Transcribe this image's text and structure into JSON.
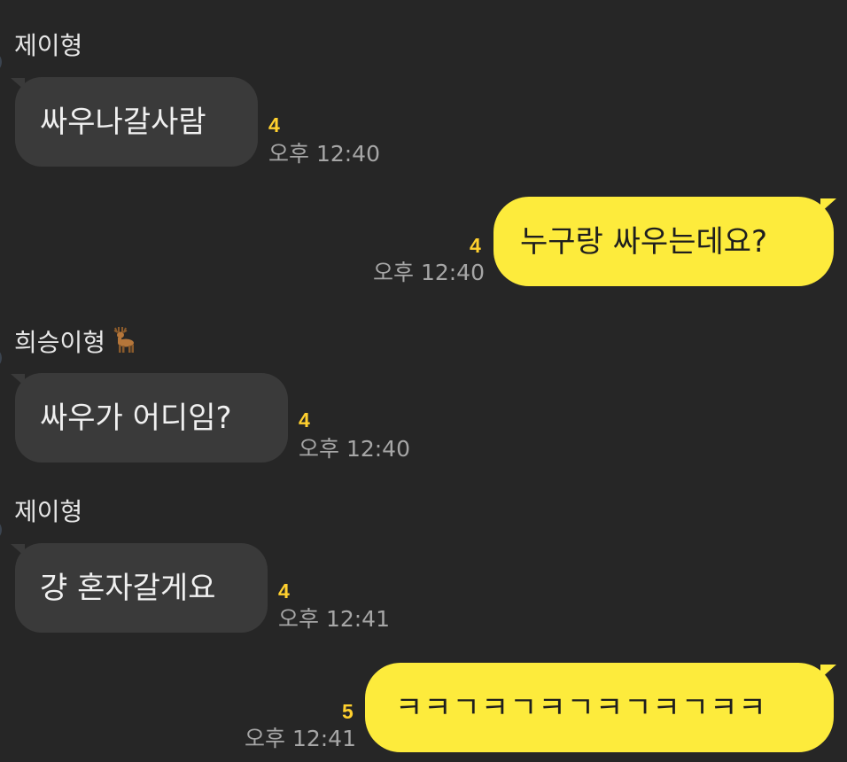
{
  "chat": {
    "messages": [
      {
        "direction": "in",
        "sender": "제이형",
        "sender_icon": "deer-emoji",
        "text": "싸우나갈사람",
        "unread": "4",
        "time": "오후 12:40"
      },
      {
        "direction": "out",
        "sender": "",
        "text": "누구랑 싸우는데요?",
        "unread": "4",
        "time": "오후 12:40"
      },
      {
        "direction": "in",
        "sender": "희승이형",
        "text": "싸우가 어디임?",
        "unread": "4",
        "time": "오후 12:40"
      },
      {
        "direction": "in",
        "sender": "제이형",
        "text": "걍 혼자갈게요",
        "unread": "4",
        "time": "오후 12:41"
      },
      {
        "direction": "out",
        "sender": "",
        "text": "ㅋㅋㄱㅋㄱㅋㄱㅋㄱㅋㄱㅋㅋ",
        "unread": "5",
        "time": "오후 12:41"
      }
    ]
  },
  "colors": {
    "background": "#262626",
    "incoming_bubble": "#3a3a3a",
    "outgoing_bubble": "#fdeb3c",
    "unread_count": "#ffd02e",
    "timestamp": "#a6a6a6"
  }
}
